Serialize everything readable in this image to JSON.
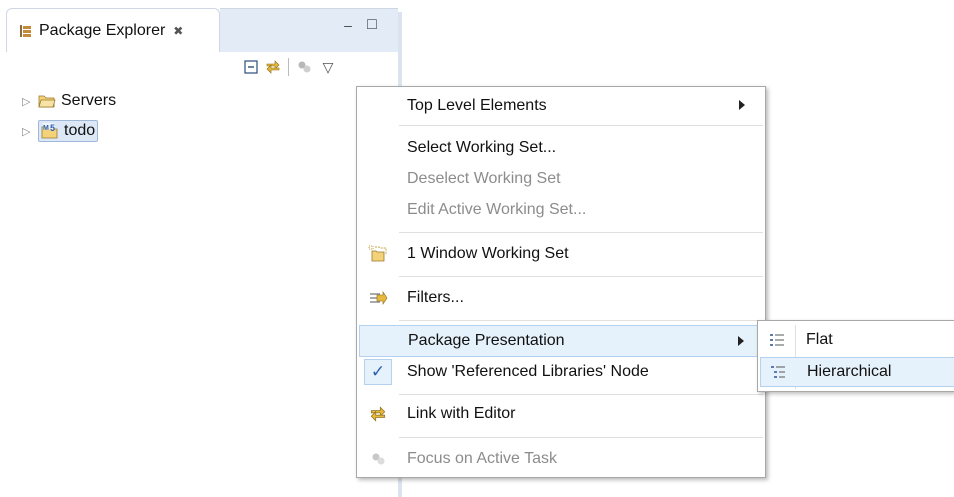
{
  "view": {
    "tab_title": "Package Explorer",
    "tab_close_glyph": "✖",
    "minimize_glyph": "–",
    "maximize_glyph": "□",
    "toolbar": {
      "collapse_all_icon": "collapse-all-icon",
      "link_with_editor_icon": "link-with-editor-icon",
      "focus_task_icon": "focus-task-icon",
      "view_menu_glyph": "▽"
    }
  },
  "tree": {
    "items": [
      {
        "label": "Servers",
        "icon": "folder-icon",
        "selected": false
      },
      {
        "label": "todo",
        "icon": "web-project-icon",
        "selected": true
      }
    ]
  },
  "menu": {
    "items": [
      {
        "label": "Top Level Elements",
        "has_submenu": true,
        "enabled": true
      },
      {
        "label": "Select Working Set...",
        "enabled": true
      },
      {
        "label": "Deselect Working Set",
        "enabled": false
      },
      {
        "label": "Edit Active Working Set...",
        "enabled": false
      },
      {
        "label": "1 Window Working Set",
        "icon": "working-set-icon",
        "enabled": true
      },
      {
        "label": "Filters...",
        "icon": "filters-icon",
        "enabled": true
      },
      {
        "label": "Package Presentation",
        "has_submenu": true,
        "enabled": true,
        "highlighted": true
      },
      {
        "label": "Show 'Referenced Libraries' Node",
        "checked": true,
        "check_glyph": "✓",
        "enabled": true
      },
      {
        "label": "Link with Editor",
        "icon": "link-with-editor-icon",
        "enabled": true
      },
      {
        "label": "Focus on Active Task",
        "icon": "focus-task-icon",
        "enabled": false
      }
    ]
  },
  "submenu": {
    "items": [
      {
        "label": "Flat",
        "icon": "flat-layout-icon"
      },
      {
        "label": "Hierarchical",
        "icon": "hierarchical-layout-icon",
        "highlighted": true
      }
    ]
  },
  "colors": {
    "highlight_bg": "#e5f1fb",
    "highlight_border": "#b4d2ef",
    "disabled_text": "#8c8c8c"
  }
}
